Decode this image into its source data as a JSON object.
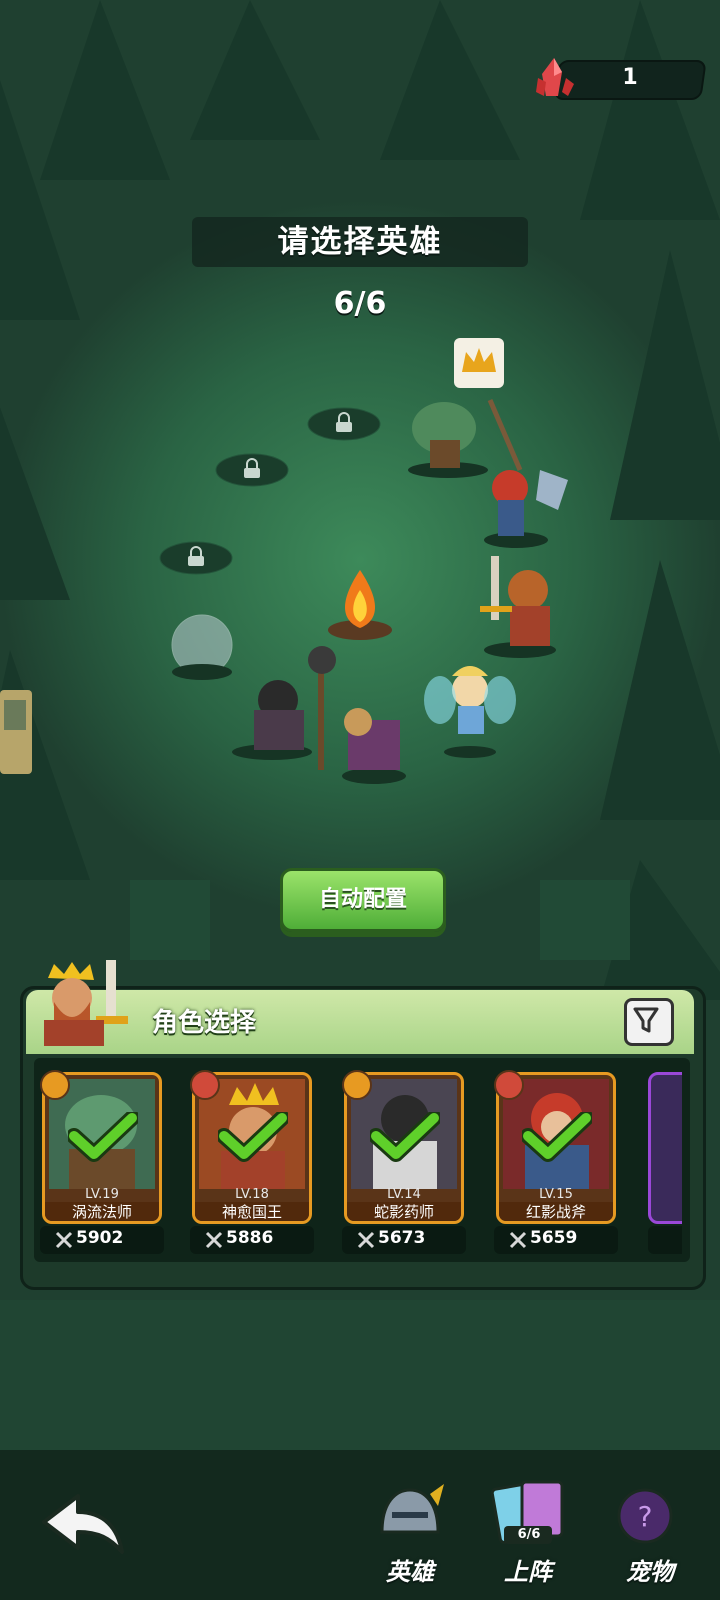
{
  "header": {
    "crystal_icon": "red-crystal-icon",
    "crystal_count": "1"
  },
  "title": "请选择英雄",
  "selection_count": "6/6",
  "auto_button": "自动配置",
  "panel": {
    "title": "角色选择",
    "filter_icon": "filter-icon",
    "cards": [
      {
        "level": "LV.19",
        "name": "涡流法师",
        "power": "5902",
        "badge_icon": "lightning-icon",
        "selected": true,
        "art_color": "#3f6b52"
      },
      {
        "level": "LV.18",
        "name": "神愈国王",
        "power": "5886",
        "badge_icon": "dumbbell-icon",
        "selected": true,
        "art_color": "#9b4a23"
      },
      {
        "level": "LV.14",
        "name": "蛇影药师",
        "power": "5673",
        "badge_icon": "lightning-icon",
        "selected": true,
        "art_color": "#4a4552"
      },
      {
        "level": "LV.15",
        "name": "红影战斧",
        "power": "5659",
        "badge_icon": "dumbbell-icon",
        "selected": true,
        "art_color": "#7a2a2a"
      }
    ]
  },
  "nav": {
    "heroes": "英雄",
    "deploy": "上阵",
    "deploy_badge": "6/6",
    "pets": "宠物"
  },
  "colors": {
    "accent_green": "#5bbf3a",
    "card_border": "#e79a22",
    "background": "#1f4030"
  }
}
